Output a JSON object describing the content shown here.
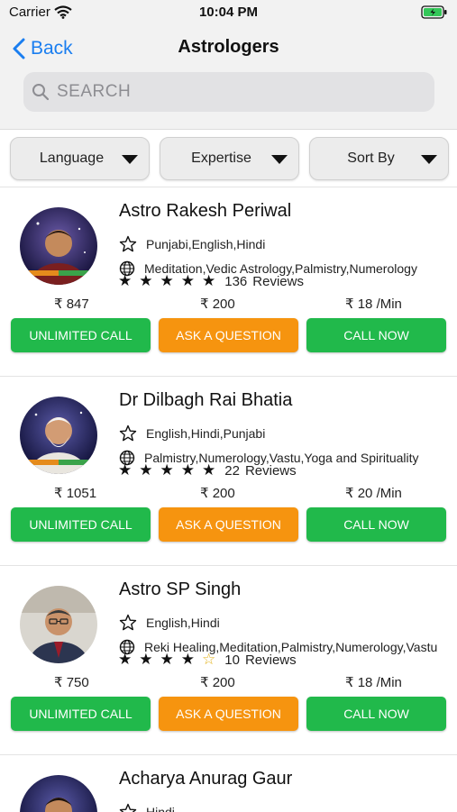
{
  "status_bar": {
    "carrier": "Carrier",
    "time": "10:04 PM"
  },
  "nav": {
    "back_label": "Back",
    "title": "Astrologers"
  },
  "search": {
    "placeholder": "SEARCH"
  },
  "filters": [
    {
      "label": "Language"
    },
    {
      "label": "Expertise"
    },
    {
      "label": "Sort By"
    }
  ],
  "astrologers": [
    {
      "name": "Astro Rakesh Periwal",
      "languages": "Punjabi,English,Hindi",
      "expertise": "Meditation,Vedic Astrology,Palmistry,Numerology",
      "rating": 5,
      "review_count": "136",
      "reviews_label": "Reviews",
      "price_unlimited": "₹ 847",
      "price_question": "₹ 200",
      "price_per_min": "₹ 18 /Min",
      "btn_unlimited": "UNLIMITED CALL",
      "btn_question": "ASK A QUESTION",
      "btn_call": "CALL NOW"
    },
    {
      "name": "Dr Dilbagh Rai Bhatia",
      "languages": "English,Hindi,Punjabi",
      "expertise": "Palmistry,Numerology,Vastu,Yoga and Spirituality",
      "rating": 5,
      "review_count": "22",
      "reviews_label": "Reviews",
      "price_unlimited": "₹ 1051",
      "price_question": "₹ 200",
      "price_per_min": "₹ 20 /Min",
      "btn_unlimited": "UNLIMITED CALL",
      "btn_question": "ASK A QUESTION",
      "btn_call": "CALL NOW"
    },
    {
      "name": "Astro SP Singh",
      "languages": "English,Hindi",
      "expertise": "Reki Healing,Meditation,Palmistry,Numerology,Vastu",
      "rating": 4,
      "review_count": "10",
      "reviews_label": "Reviews",
      "price_unlimited": "₹ 750",
      "price_question": "₹ 200",
      "price_per_min": "₹ 18 /Min",
      "btn_unlimited": "UNLIMITED CALL",
      "btn_question": "ASK A QUESTION",
      "btn_call": "CALL NOW"
    },
    {
      "name": "Acharya Anurag Gaur",
      "languages": "Hindi"
    }
  ],
  "colors": {
    "accent": "#1a7ef0",
    "green": "#21b94b",
    "orange": "#f6940f"
  }
}
